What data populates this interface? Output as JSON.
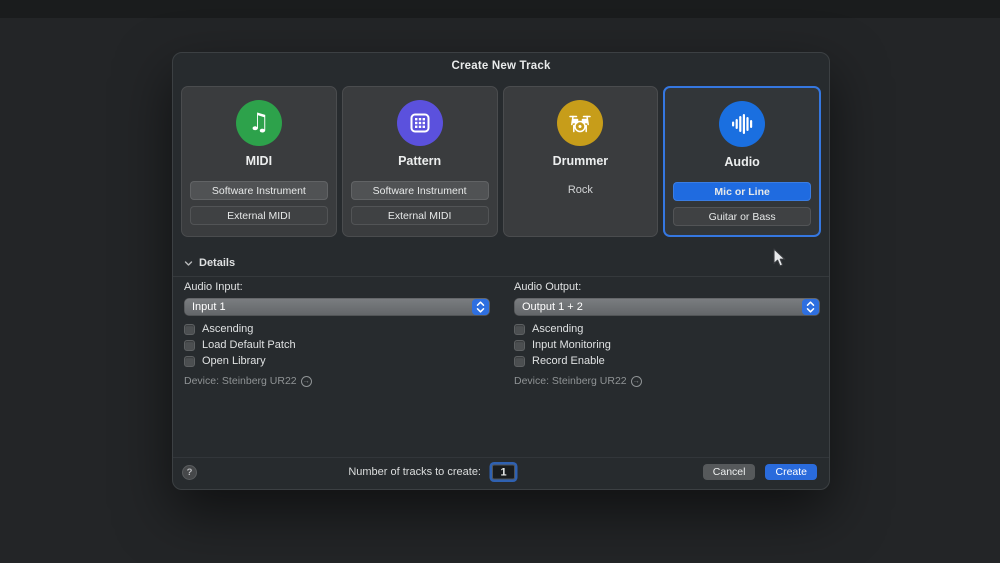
{
  "window": {
    "title": "Create New Track"
  },
  "track_cards": [
    {
      "label": "MIDI",
      "icon": "music-note-icon",
      "options": [
        "Software Instrument",
        "External MIDI"
      ],
      "selected": false
    },
    {
      "label": "Pattern",
      "icon": "pattern-grid-icon",
      "options": [
        "Software Instrument",
        "External MIDI"
      ],
      "selected": false
    },
    {
      "label": "Drummer",
      "icon": "drum-kit-icon",
      "subtitle": "Rock",
      "selected": false
    },
    {
      "label": "Audio",
      "icon": "waveform-icon",
      "options": [
        "Mic or Line",
        "Guitar or Bass"
      ],
      "selected": true
    }
  ],
  "details": {
    "header_label": "Details",
    "audio_input": {
      "label": "Audio Input:",
      "value": "Input 1",
      "checkboxes": [
        {
          "label": "Ascending",
          "checked": false
        },
        {
          "label": "Load Default Patch",
          "checked": false
        },
        {
          "label": "Open Library",
          "checked": false
        }
      ],
      "device_label": "Device: Steinberg UR22"
    },
    "audio_output": {
      "label": "Audio Output:",
      "value": "Output 1 + 2",
      "checkboxes": [
        {
          "label": "Ascending",
          "checked": false
        },
        {
          "label": "Input Monitoring",
          "checked": false
        },
        {
          "label": "Record Enable",
          "checked": false
        }
      ],
      "device_label": "Device: Steinberg UR22"
    }
  },
  "footer": {
    "help": "?",
    "tracks_label": "Number of tracks to create:",
    "tracks_value": "1",
    "cancel": "Cancel",
    "create": "Create"
  },
  "icons": {
    "device_arrow": "→",
    "midi_note": "♫"
  },
  "colors": {
    "accent": "#2a6bdc",
    "midi_green": "#2da24b",
    "pattern_purple": "#5b51dd",
    "drummer_gold": "#c79d1a",
    "audio_blue": "#1a6fe0",
    "selection_border": "#3577e0"
  }
}
